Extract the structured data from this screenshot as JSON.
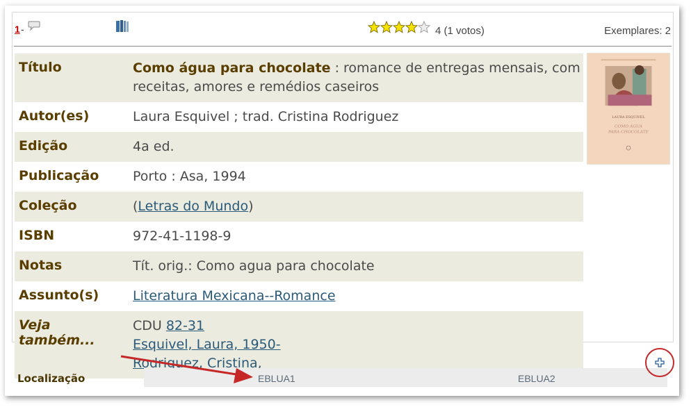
{
  "record": {
    "number": "1",
    "dash": "-",
    "rating_votes": "4 (1 votos)",
    "rating": 4,
    "rating_max": 5,
    "copies": "Exemplares: 2"
  },
  "fields": {
    "title_label": "Título",
    "title_main": "Como água para chocolate",
    "title_rest": " : romance de entregas mensais, com receitas, amores e remédios caseiros",
    "author_label": "Autor(es)",
    "author": "Laura Esquivel ; trad. Cristina Rodriguez",
    "edition_label": "Edição",
    "edition": "4a ed.",
    "publication_label": "Publicação",
    "publication": "Porto : Asa, 1994",
    "collection_label": "Coleção",
    "collection_open": "(",
    "collection": "Letras do Mundo",
    "collection_close": ")",
    "isbn_label": "ISBN",
    "isbn": "972-41-1198-9",
    "notes_label": "Notas",
    "notes": "Tít. orig.: Como agua para chocolate",
    "subjects_label": "Assunto(s)",
    "subject": "Literatura Mexicana--Romance",
    "see_also_label": "Veja também...",
    "see_also_cdu_prefix": "CDU ",
    "see_also_cdu": "82-31",
    "see_also_1": "Esquivel, Laura, 1950-",
    "see_also_2": "Rodriguez, Cristina, "
  },
  "cover": {
    "author": "LAURA ESQUIVEL",
    "title_1": "COMO ÁGUA",
    "title_2": "PARA CHOCOLATE"
  },
  "location": {
    "label": "Localização",
    "items": [
      "EBLUA1",
      "EBLUA2"
    ]
  },
  "icons": {
    "comment": "speech-bubble-icon",
    "book": "books-icon",
    "star": "star-icon",
    "expand": "plus-icon"
  },
  "colors": {
    "label": "#5a3e00",
    "link": "#2a5a7a",
    "row_shade": "#ecebdf",
    "annotation": "#c62828",
    "star_fill": "#f5e200"
  }
}
